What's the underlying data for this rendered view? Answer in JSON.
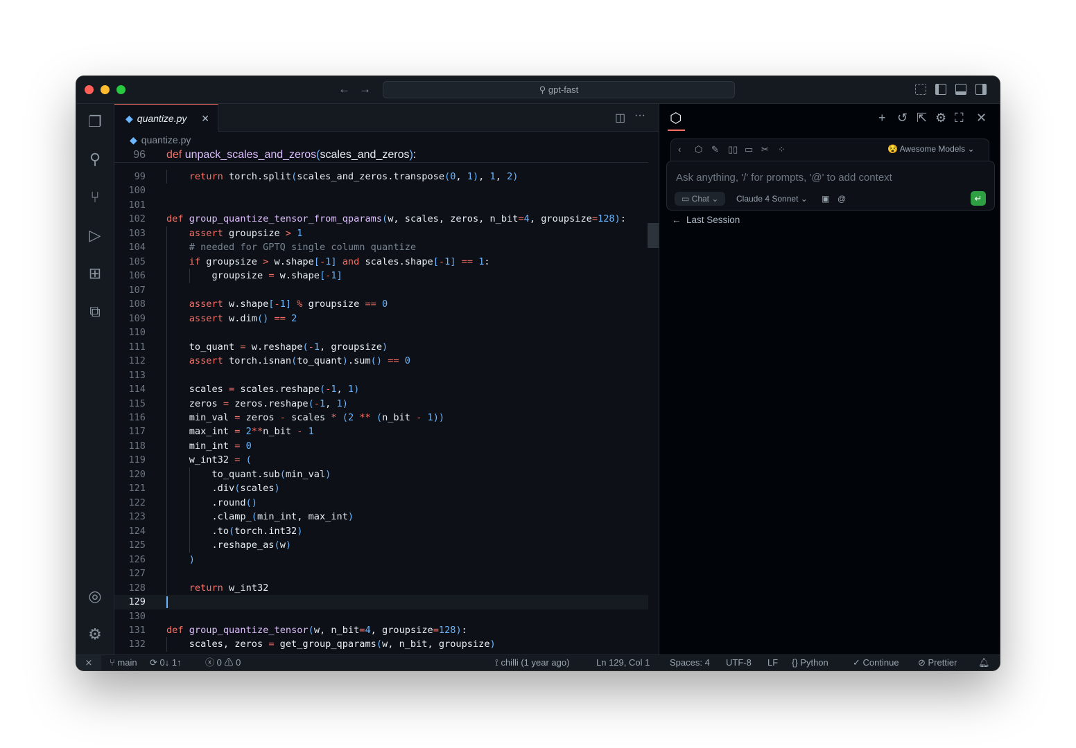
{
  "titlebar": {
    "search": "gpt-fast",
    "search_icon": "search-icon"
  },
  "activity_bar": [
    "files-icon",
    "search-icon",
    "source-control-icon",
    "run-debug-icon",
    "extensions-icon",
    "remote-explorer-icon"
  ],
  "activity_bottom": [
    "account-icon",
    "settings-gear-icon"
  ],
  "editor": {
    "tab": {
      "label": "quantize.py",
      "icon": "python-icon"
    },
    "breadcrumb": "quantize.py",
    "sticky": {
      "num": "96",
      "tokens": [
        [
          "k",
          "def"
        ],
        [
          "t",
          " "
        ],
        [
          "f",
          "unpack_scales_and_zeros"
        ],
        [
          "p",
          "("
        ],
        [
          "t",
          "scales_and_zeros"
        ],
        [
          "p",
          ")"
        ],
        [
          "t",
          ":"
        ]
      ]
    },
    "current_line": "129",
    "lines": [
      {
        "num": "99",
        "tokens": [
          [
            "t",
            "    "
          ],
          [
            "k",
            "return"
          ],
          [
            "t",
            " torch.split"
          ],
          [
            "p",
            "("
          ],
          [
            "t",
            "scales_and_zeros.transpose"
          ],
          [
            "p",
            "("
          ],
          [
            "n",
            "0"
          ],
          [
            "t",
            ", "
          ],
          [
            "n",
            "1"
          ],
          [
            "p",
            ")"
          ],
          [
            "t",
            ", "
          ],
          [
            "n",
            "1"
          ],
          [
            "t",
            ", "
          ],
          [
            "n",
            "2"
          ],
          [
            "p",
            ")"
          ]
        ]
      },
      {
        "num": "100",
        "tokens": []
      },
      {
        "num": "101",
        "tokens": []
      },
      {
        "num": "102",
        "tokens": [
          [
            "k",
            "def"
          ],
          [
            "t",
            " "
          ],
          [
            "f",
            "group_quantize_tensor_from_qparams"
          ],
          [
            "p",
            "("
          ],
          [
            "t",
            "w, scales, zeros, n_bit"
          ],
          [
            "o",
            "="
          ],
          [
            "n",
            "4"
          ],
          [
            "t",
            ", groupsize"
          ],
          [
            "o",
            "="
          ],
          [
            "n",
            "128"
          ],
          [
            "p",
            ")"
          ],
          [
            "t",
            ":"
          ]
        ]
      },
      {
        "num": "103",
        "tokens": [
          [
            "t",
            "    "
          ],
          [
            "k",
            "assert"
          ],
          [
            "t",
            " groupsize "
          ],
          [
            "o",
            ">"
          ],
          [
            "t",
            " "
          ],
          [
            "n",
            "1"
          ]
        ]
      },
      {
        "num": "104",
        "tokens": [
          [
            "t",
            "    "
          ],
          [
            "c",
            "# needed for GPTQ single column quantize"
          ]
        ]
      },
      {
        "num": "105",
        "tokens": [
          [
            "t",
            "    "
          ],
          [
            "k",
            "if"
          ],
          [
            "t",
            " groupsize "
          ],
          [
            "o",
            ">"
          ],
          [
            "t",
            " w.shape"
          ],
          [
            "p",
            "["
          ],
          [
            "o",
            "-"
          ],
          [
            "n",
            "1"
          ],
          [
            "p",
            "]"
          ],
          [
            "t",
            " "
          ],
          [
            "k",
            "and"
          ],
          [
            "t",
            " scales.shape"
          ],
          [
            "p",
            "["
          ],
          [
            "o",
            "-"
          ],
          [
            "n",
            "1"
          ],
          [
            "p",
            "]"
          ],
          [
            "t",
            " "
          ],
          [
            "o",
            "=="
          ],
          [
            "t",
            " "
          ],
          [
            "n",
            "1"
          ],
          [
            "t",
            ":"
          ]
        ]
      },
      {
        "num": "106",
        "tokens": [
          [
            "t",
            "        "
          ],
          [
            "t",
            "groupsize "
          ],
          [
            "o",
            "="
          ],
          [
            "t",
            " w.shape"
          ],
          [
            "p",
            "["
          ],
          [
            "o",
            "-"
          ],
          [
            "n",
            "1"
          ],
          [
            "p",
            "]"
          ]
        ]
      },
      {
        "num": "107",
        "tokens": []
      },
      {
        "num": "108",
        "tokens": [
          [
            "t",
            "    "
          ],
          [
            "k",
            "assert"
          ],
          [
            "t",
            " w.shape"
          ],
          [
            "p",
            "["
          ],
          [
            "o",
            "-"
          ],
          [
            "n",
            "1"
          ],
          [
            "p",
            "]"
          ],
          [
            "t",
            " "
          ],
          [
            "o",
            "%"
          ],
          [
            "t",
            " groupsize "
          ],
          [
            "o",
            "=="
          ],
          [
            "t",
            " "
          ],
          [
            "n",
            "0"
          ]
        ]
      },
      {
        "num": "109",
        "tokens": [
          [
            "t",
            "    "
          ],
          [
            "k",
            "assert"
          ],
          [
            "t",
            " w.dim"
          ],
          [
            "p",
            "()"
          ],
          [
            "t",
            " "
          ],
          [
            "o",
            "=="
          ],
          [
            "t",
            " "
          ],
          [
            "n",
            "2"
          ]
        ]
      },
      {
        "num": "110",
        "tokens": []
      },
      {
        "num": "111",
        "tokens": [
          [
            "t",
            "    "
          ],
          [
            "t",
            "to_quant "
          ],
          [
            "o",
            "="
          ],
          [
            "t",
            " w.reshape"
          ],
          [
            "p",
            "("
          ],
          [
            "o",
            "-"
          ],
          [
            "n",
            "1"
          ],
          [
            "t",
            ", groupsize"
          ],
          [
            "p",
            ")"
          ]
        ]
      },
      {
        "num": "112",
        "tokens": [
          [
            "t",
            "    "
          ],
          [
            "k",
            "assert"
          ],
          [
            "t",
            " torch.isnan"
          ],
          [
            "p",
            "("
          ],
          [
            "t",
            "to_quant"
          ],
          [
            "p",
            ")"
          ],
          [
            "t",
            ".sum"
          ],
          [
            "p",
            "()"
          ],
          [
            "t",
            " "
          ],
          [
            "o",
            "=="
          ],
          [
            "t",
            " "
          ],
          [
            "n",
            "0"
          ]
        ]
      },
      {
        "num": "113",
        "tokens": []
      },
      {
        "num": "114",
        "tokens": [
          [
            "t",
            "    "
          ],
          [
            "t",
            "scales "
          ],
          [
            "o",
            "="
          ],
          [
            "t",
            " scales.reshape"
          ],
          [
            "p",
            "("
          ],
          [
            "o",
            "-"
          ],
          [
            "n",
            "1"
          ],
          [
            "t",
            ", "
          ],
          [
            "n",
            "1"
          ],
          [
            "p",
            ")"
          ]
        ]
      },
      {
        "num": "115",
        "tokens": [
          [
            "t",
            "    "
          ],
          [
            "t",
            "zeros "
          ],
          [
            "o",
            "="
          ],
          [
            "t",
            " zeros.reshape"
          ],
          [
            "p",
            "("
          ],
          [
            "o",
            "-"
          ],
          [
            "n",
            "1"
          ],
          [
            "t",
            ", "
          ],
          [
            "n",
            "1"
          ],
          [
            "p",
            ")"
          ]
        ]
      },
      {
        "num": "116",
        "tokens": [
          [
            "t",
            "    "
          ],
          [
            "t",
            "min_val "
          ],
          [
            "o",
            "="
          ],
          [
            "t",
            " zeros "
          ],
          [
            "o",
            "-"
          ],
          [
            "t",
            " scales "
          ],
          [
            "o",
            "*"
          ],
          [
            "t",
            " "
          ],
          [
            "p",
            "("
          ],
          [
            "n",
            "2"
          ],
          [
            "t",
            " "
          ],
          [
            "o",
            "**"
          ],
          [
            "t",
            " "
          ],
          [
            "p",
            "("
          ],
          [
            "t",
            "n_bit "
          ],
          [
            "o",
            "-"
          ],
          [
            "t",
            " "
          ],
          [
            "n",
            "1"
          ],
          [
            "p",
            "))"
          ]
        ]
      },
      {
        "num": "117",
        "tokens": [
          [
            "t",
            "    "
          ],
          [
            "t",
            "max_int "
          ],
          [
            "o",
            "="
          ],
          [
            "t",
            " "
          ],
          [
            "n",
            "2"
          ],
          [
            "o",
            "**"
          ],
          [
            "t",
            "n_bit "
          ],
          [
            "o",
            "-"
          ],
          [
            "t",
            " "
          ],
          [
            "n",
            "1"
          ]
        ]
      },
      {
        "num": "118",
        "tokens": [
          [
            "t",
            "    "
          ],
          [
            "t",
            "min_int "
          ],
          [
            "o",
            "="
          ],
          [
            "t",
            " "
          ],
          [
            "n",
            "0"
          ]
        ]
      },
      {
        "num": "119",
        "tokens": [
          [
            "t",
            "    "
          ],
          [
            "t",
            "w_int32 "
          ],
          [
            "o",
            "="
          ],
          [
            "t",
            " "
          ],
          [
            "p",
            "("
          ]
        ]
      },
      {
        "num": "120",
        "tokens": [
          [
            "t",
            "        "
          ],
          [
            "t",
            "to_quant.sub"
          ],
          [
            "p",
            "("
          ],
          [
            "t",
            "min_val"
          ],
          [
            "p",
            ")"
          ]
        ]
      },
      {
        "num": "121",
        "tokens": [
          [
            "t",
            "        "
          ],
          [
            "t",
            ".div"
          ],
          [
            "p",
            "("
          ],
          [
            "t",
            "scales"
          ],
          [
            "p",
            ")"
          ]
        ]
      },
      {
        "num": "122",
        "tokens": [
          [
            "t",
            "        "
          ],
          [
            "t",
            ".round"
          ],
          [
            "p",
            "()"
          ]
        ]
      },
      {
        "num": "123",
        "tokens": [
          [
            "t",
            "        "
          ],
          [
            "t",
            ".clamp_"
          ],
          [
            "p",
            "("
          ],
          [
            "t",
            "min_int, max_int"
          ],
          [
            "p",
            ")"
          ]
        ]
      },
      {
        "num": "124",
        "tokens": [
          [
            "t",
            "        "
          ],
          [
            "t",
            ".to"
          ],
          [
            "p",
            "("
          ],
          [
            "t",
            "torch.int32"
          ],
          [
            "p",
            ")"
          ]
        ]
      },
      {
        "num": "125",
        "tokens": [
          [
            "t",
            "        "
          ],
          [
            "t",
            ".reshape_as"
          ],
          [
            "p",
            "("
          ],
          [
            "t",
            "w"
          ],
          [
            "p",
            ")"
          ]
        ]
      },
      {
        "num": "126",
        "tokens": [
          [
            "t",
            "    "
          ],
          [
            "p",
            ")"
          ]
        ]
      },
      {
        "num": "127",
        "tokens": []
      },
      {
        "num": "128",
        "tokens": [
          [
            "t",
            "    "
          ],
          [
            "k",
            "return"
          ],
          [
            "t",
            " w_int32"
          ]
        ]
      },
      {
        "num": "129",
        "tokens": []
      },
      {
        "num": "130",
        "tokens": []
      },
      {
        "num": "131",
        "tokens": [
          [
            "k",
            "def"
          ],
          [
            "t",
            " "
          ],
          [
            "f",
            "group_quantize_tensor"
          ],
          [
            "p",
            "("
          ],
          [
            "t",
            "w, n_bit"
          ],
          [
            "o",
            "="
          ],
          [
            "n",
            "4"
          ],
          [
            "t",
            ", groupsize"
          ],
          [
            "o",
            "="
          ],
          [
            "n",
            "128"
          ],
          [
            "p",
            ")"
          ],
          [
            "t",
            ":"
          ]
        ]
      },
      {
        "num": "132",
        "tokens": [
          [
            "t",
            "    "
          ],
          [
            "t",
            "scales, zeros "
          ],
          [
            "o",
            "="
          ],
          [
            "t",
            " get_group_qparams"
          ],
          [
            "p",
            "("
          ],
          [
            "t",
            "w, n_bit, groupsize"
          ],
          [
            "p",
            ")"
          ]
        ]
      }
    ]
  },
  "panel": {
    "header_icons": [
      "new-chat-icon",
      "history-icon",
      "open-external-icon",
      "settings-icon",
      "fullscreen-icon",
      "close-icon"
    ],
    "toolbar_icons": [
      "back-icon",
      "cube-icon",
      "pencil-icon",
      "book-icon",
      "comment-icon",
      "tools-icon",
      "grid-icon"
    ],
    "models_label": "Awesome Models",
    "input_placeholder": "Ask anything, '/' for prompts, '@' to add context",
    "mode": "Chat",
    "model": "Claude 4 Sonnet",
    "last_session": "Last Session",
    "accent": "#2ea043"
  },
  "status": {
    "branch": "main",
    "sync": "0↓ 1↑",
    "errors": "0",
    "warnings": "0",
    "blame": "chilli (1 year ago)",
    "position": "Ln 129, Col 1",
    "spaces": "Spaces: 4",
    "encoding": "UTF-8",
    "eol": "LF",
    "language": "Python",
    "continue": "Continue",
    "prettier": "Prettier"
  }
}
